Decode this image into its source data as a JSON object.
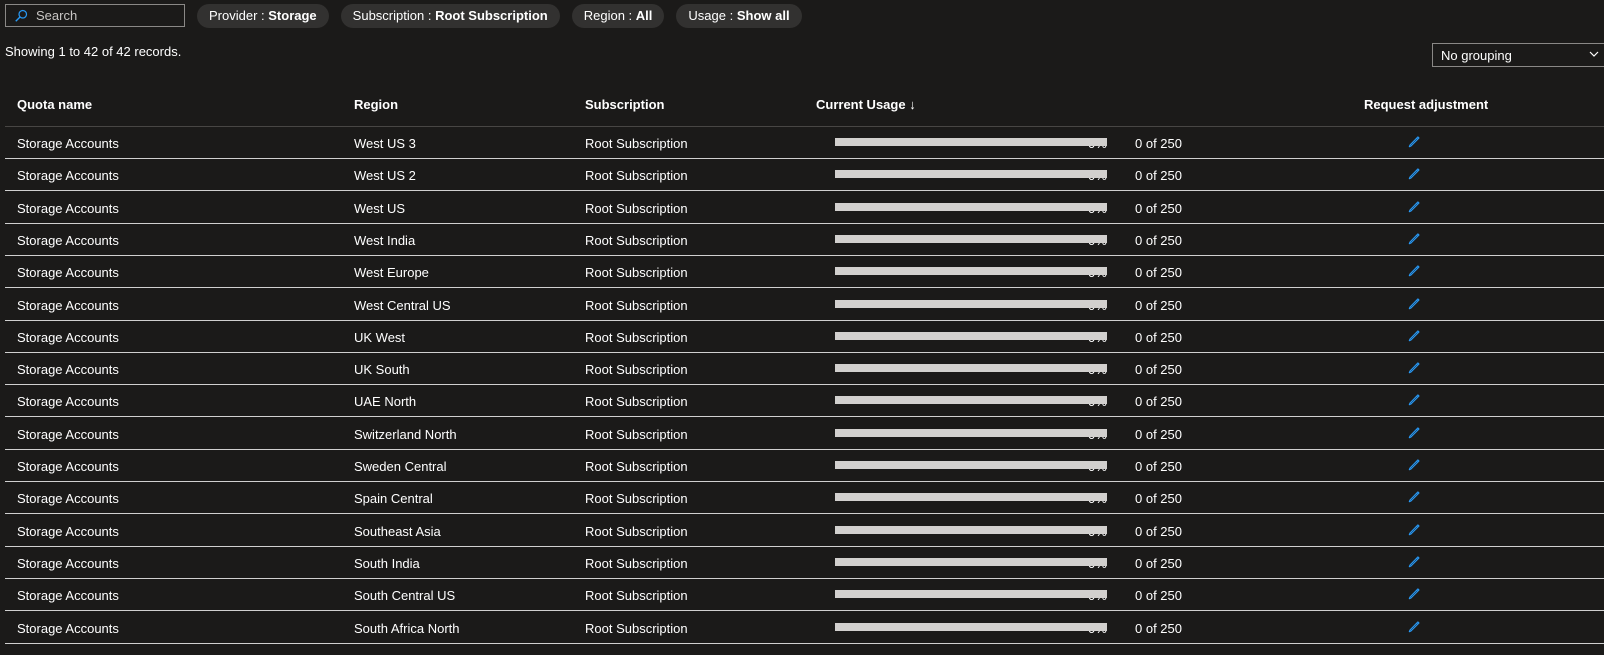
{
  "search": {
    "placeholder": "Search",
    "value": ""
  },
  "filters": [
    {
      "key": "Provider : ",
      "value": "Storage"
    },
    {
      "key": "Subscription : ",
      "value": "Root Subscription"
    },
    {
      "key": "Region : ",
      "value": "All"
    },
    {
      "key": "Usage : ",
      "value": "Show all"
    }
  ],
  "records_text": "Showing 1 to 42 of 42 records.",
  "grouping": {
    "selected": "No grouping"
  },
  "columns": {
    "quota_name": "Quota name",
    "region": "Region",
    "subscription": "Subscription",
    "current_usage": "Current Usage ↓",
    "request_adjustment": "Request adjustment"
  },
  "rows": [
    {
      "quota": "Storage Accounts",
      "region": "West US 3",
      "subscription": "Root Subscription",
      "percent": "0%",
      "usage": "0 of 250",
      "fraction": 0
    },
    {
      "quota": "Storage Accounts",
      "region": "West US 2",
      "subscription": "Root Subscription",
      "percent": "0%",
      "usage": "0 of 250",
      "fraction": 0
    },
    {
      "quota": "Storage Accounts",
      "region": "West US",
      "subscription": "Root Subscription",
      "percent": "0%",
      "usage": "0 of 250",
      "fraction": 0
    },
    {
      "quota": "Storage Accounts",
      "region": "West India",
      "subscription": "Root Subscription",
      "percent": "0%",
      "usage": "0 of 250",
      "fraction": 0
    },
    {
      "quota": "Storage Accounts",
      "region": "West Europe",
      "subscription": "Root Subscription",
      "percent": "0%",
      "usage": "0 of 250",
      "fraction": 0
    },
    {
      "quota": "Storage Accounts",
      "region": "West Central US",
      "subscription": "Root Subscription",
      "percent": "0%",
      "usage": "0 of 250",
      "fraction": 0
    },
    {
      "quota": "Storage Accounts",
      "region": "UK West",
      "subscription": "Root Subscription",
      "percent": "0%",
      "usage": "0 of 250",
      "fraction": 0
    },
    {
      "quota": "Storage Accounts",
      "region": "UK South",
      "subscription": "Root Subscription",
      "percent": "0%",
      "usage": "0 of 250",
      "fraction": 0
    },
    {
      "quota": "Storage Accounts",
      "region": "UAE North",
      "subscription": "Root Subscription",
      "percent": "0%",
      "usage": "0 of 250",
      "fraction": 0
    },
    {
      "quota": "Storage Accounts",
      "region": "Switzerland North",
      "subscription": "Root Subscription",
      "percent": "0%",
      "usage": "0 of 250",
      "fraction": 0
    },
    {
      "quota": "Storage Accounts",
      "region": "Sweden Central",
      "subscription": "Root Subscription",
      "percent": "0%",
      "usage": "0 of 250",
      "fraction": 0
    },
    {
      "quota": "Storage Accounts",
      "region": "Spain Central",
      "subscription": "Root Subscription",
      "percent": "0%",
      "usage": "0 of 250",
      "fraction": 0
    },
    {
      "quota": "Storage Accounts",
      "region": "Southeast Asia",
      "subscription": "Root Subscription",
      "percent": "0%",
      "usage": "0 of 250",
      "fraction": 0
    },
    {
      "quota": "Storage Accounts",
      "region": "South India",
      "subscription": "Root Subscription",
      "percent": "0%",
      "usage": "0 of 250",
      "fraction": 0
    },
    {
      "quota": "Storage Accounts",
      "region": "South Central US",
      "subscription": "Root Subscription",
      "percent": "0%",
      "usage": "0 of 250",
      "fraction": 0
    },
    {
      "quota": "Storage Accounts",
      "region": "South Africa North",
      "subscription": "Root Subscription",
      "percent": "0%",
      "usage": "0 of 250",
      "fraction": 0
    }
  ],
  "colors": {
    "accent": "#2899f5",
    "background": "#1b1a19",
    "pill": "#323130",
    "bar_track": "#d2d0ce"
  },
  "icons": {
    "search": "search-icon",
    "edit": "edit-pencil-icon",
    "dropdown": "chevron-down-icon"
  }
}
